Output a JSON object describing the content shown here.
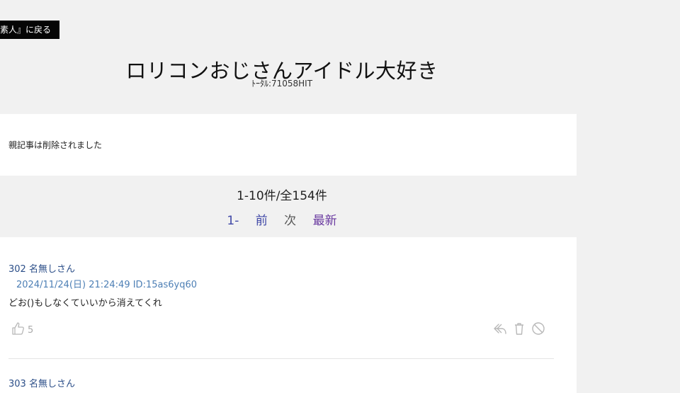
{
  "nav": {
    "back_label": "素人』に戻る"
  },
  "thread": {
    "title": "ロリコンおじさんアイドル大好き",
    "total_hits": "ﾄｰﾀﾙ:71058HIT"
  },
  "parent": {
    "message": "親記事は削除されました"
  },
  "pagination": {
    "range": "1-10件/全154件",
    "first": "1-",
    "prev": "前",
    "next": "次",
    "latest": "最新"
  },
  "posts": [
    {
      "header": "302 名無しさん",
      "date": "2024/11/24(日) 21:24:49 ID:15as6yq60",
      "body": "どお()もしなくていいから消えてくれ",
      "likes": "5",
      "icons": [
        "thumbs-up-icon",
        "reply-icon",
        "trash-icon",
        "block-icon"
      ]
    },
    {
      "header": "303 名無しさん"
    }
  ],
  "colors": {
    "background": "#f1f1f1",
    "panel": "#ffffff",
    "link_blue": "#3f47a6",
    "link_purple": "#6a3aa0",
    "post_header": "#2b4e88",
    "post_date": "#4d7fb5",
    "icon_gray": "#b8b8b8"
  }
}
